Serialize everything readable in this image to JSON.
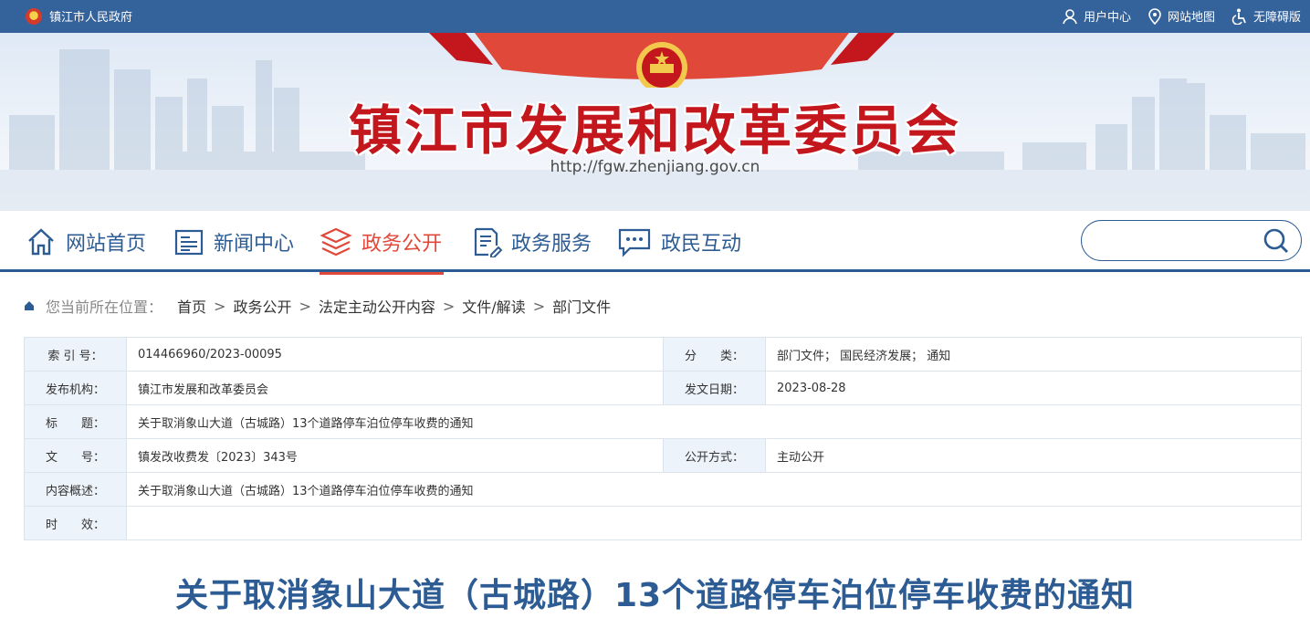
{
  "top": {
    "site_name": "镇江市人民政府",
    "links": [
      "用户中心",
      "网站地图",
      "无障碍版"
    ]
  },
  "banner": {
    "title": "镇江市发展和改革委员会",
    "url": "http://fgw.zhenjiang.gov.cn"
  },
  "nav": {
    "items": [
      "网站首页",
      "新闻中心",
      "政务公开",
      "政务服务",
      "政民互动"
    ],
    "active": "政务公开",
    "search_placeholder": ""
  },
  "breadcrumb": {
    "label": "您当前所在位置：",
    "items": [
      "首页",
      "政务公开",
      "法定主动公开内容",
      "文件/解读",
      "部门文件"
    ]
  },
  "info": {
    "index_key": "索 引 号：",
    "index_val": "014466960/2023-00095",
    "category_key": "分　　类：",
    "category_val": "部门文件； 国民经济发展； 通知",
    "org_key": "发布机构：",
    "org_val": "镇江市发展和改革委员会",
    "date_key": "发文日期：",
    "date_val": "2023-08-28",
    "title_key": "标　　题：",
    "title_val": "关于取消象山大道（古城路）13个道路停车泊位停车收费的通知",
    "docno_key": "文　　号：",
    "docno_val": "镇发改收费发〔2023〕343号",
    "mode_key": "公开方式：",
    "mode_val": "主动公开",
    "summary_key": "内容概述：",
    "summary_val": "关于取消象山大道（古城路）13个道路停车泊位停车收费的通知",
    "validity_key": "时　　效：",
    "validity_val": ""
  },
  "headline": "关于取消象山大道（古城路）13个道路停车泊位停车收费的通知",
  "colors": {
    "primary": "#2c5c93",
    "topbar": "#34629b",
    "accent": "#e0483a",
    "title_red": "#c3171d"
  }
}
